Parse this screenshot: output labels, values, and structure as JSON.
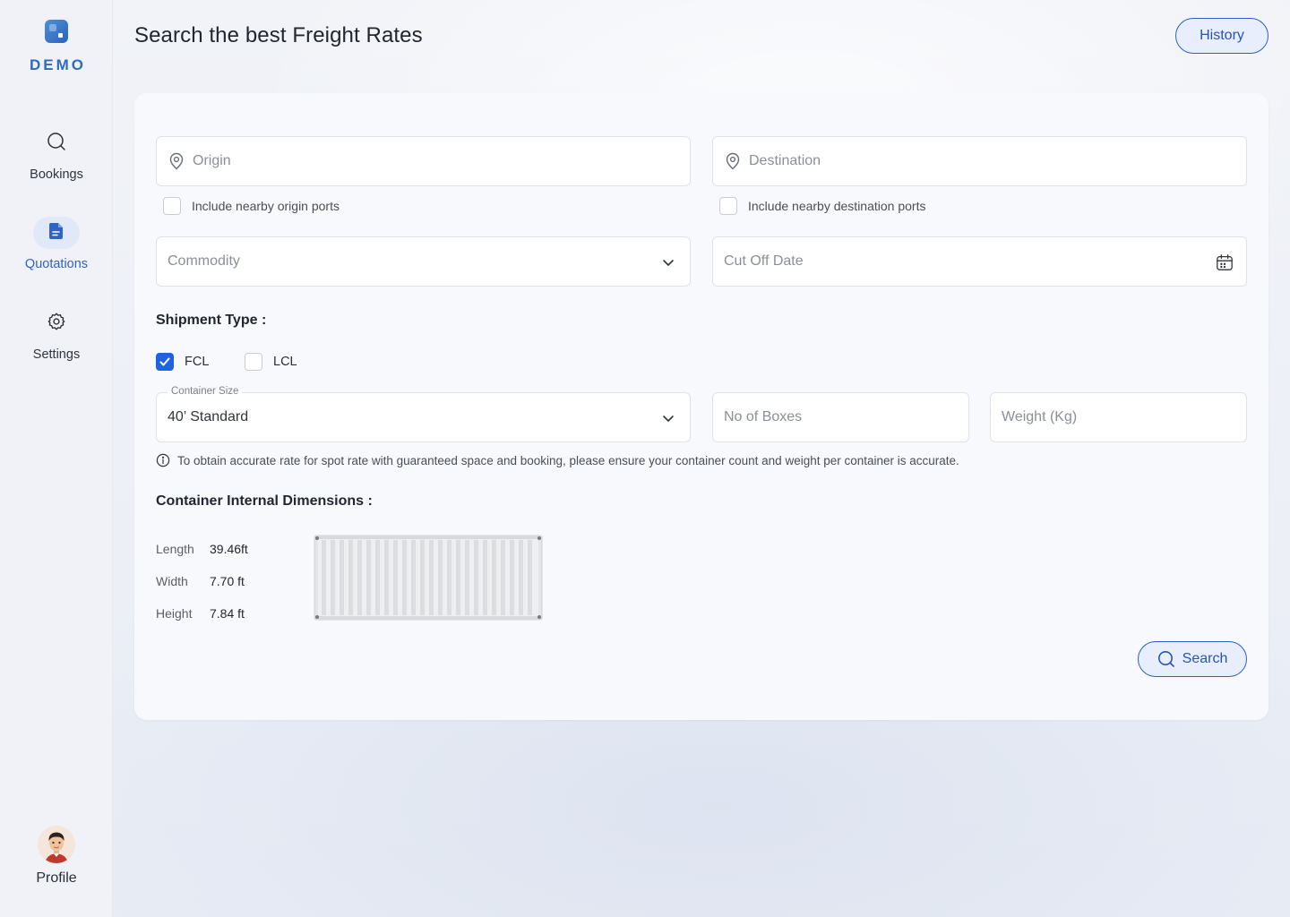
{
  "app": {
    "logo_text": "DEMO",
    "page_title": "Search the best Freight Rates",
    "history_label": "History",
    "accent_color": "#2E63C7",
    "checked_color": "#1F63E0"
  },
  "sidebar": {
    "items": [
      {
        "label": "Bookings",
        "icon": "search-icon",
        "active": false
      },
      {
        "label": "Quotations",
        "icon": "document-icon",
        "active": true
      },
      {
        "label": "Settings",
        "icon": "gear-icon",
        "active": false
      }
    ],
    "profile_label": "Profile"
  },
  "form": {
    "origin_placeholder": "Origin",
    "destination_placeholder": "Destination",
    "nearby_origin_label": "Include nearby origin ports",
    "nearby_origin_checked": false,
    "nearby_destination_label": "Include nearby destination ports",
    "nearby_destination_checked": false,
    "commodity_placeholder": "Commodity",
    "cutoff_placeholder": "Cut Off Date",
    "shipment_type_title": "Shipment Type :",
    "shipment_types": [
      {
        "label": "FCL",
        "checked": true
      },
      {
        "label": "LCL",
        "checked": false
      }
    ],
    "container_size_label": "Container Size",
    "container_size_value": "40’ Standard",
    "boxes_placeholder": "No of Boxes",
    "weight_placeholder": "Weight (Kg)",
    "info_note": "To obtain accurate rate for spot rate with guaranteed space and booking, please ensure your container count and weight per container is accurate.",
    "dimensions_title": "Container Internal Dimensions :",
    "dimensions": [
      {
        "key": "Length",
        "value": "39.46ft"
      },
      {
        "key": "Width",
        "value": "7.70 ft"
      },
      {
        "key": "Height",
        "value": "7.84 ft"
      }
    ],
    "search_label": "Search"
  }
}
